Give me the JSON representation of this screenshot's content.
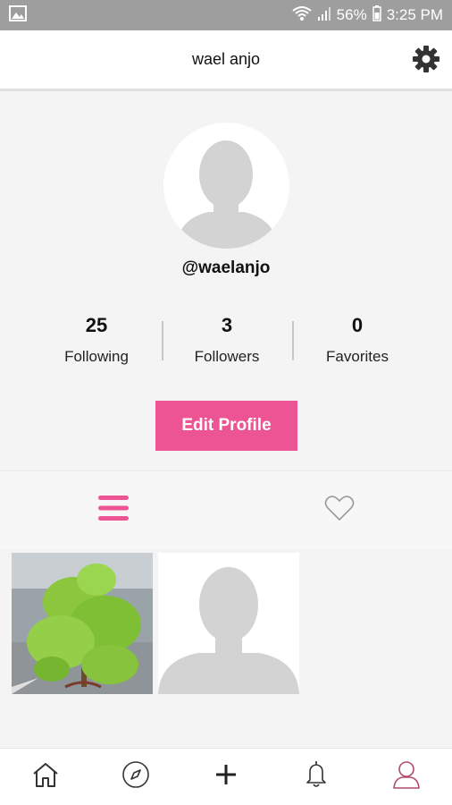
{
  "status_bar": {
    "battery_percent": "56%",
    "time": "3:25 PM",
    "icons": [
      "image-icon",
      "wifi-icon",
      "signal-icon",
      "battery-icon"
    ]
  },
  "header": {
    "title": "wael anjo",
    "settings_icon": "gear-icon"
  },
  "profile": {
    "username": "@waelanjo",
    "stats": [
      {
        "value": "25",
        "label": "Following"
      },
      {
        "value": "3",
        "label": "Followers"
      },
      {
        "value": "0",
        "label": "Favorites"
      }
    ],
    "edit_button": "Edit Profile"
  },
  "tabs": [
    {
      "icon": "list-icon",
      "active": true
    },
    {
      "icon": "heart-icon",
      "active": false
    }
  ],
  "grid": [
    {
      "type": "photo",
      "subject": "green plant"
    },
    {
      "type": "placeholder",
      "subject": "default avatar"
    }
  ],
  "bottom_nav": [
    {
      "icon": "home-icon"
    },
    {
      "icon": "compass-icon"
    },
    {
      "icon": "plus-icon"
    },
    {
      "icon": "bell-icon"
    },
    {
      "icon": "profile-icon",
      "active": true
    }
  ],
  "colors": {
    "accent": "#ec5494",
    "status_bar": "#9e9e9e",
    "placeholder": "#d3d3d3",
    "active_profile": "#b04a6e"
  }
}
